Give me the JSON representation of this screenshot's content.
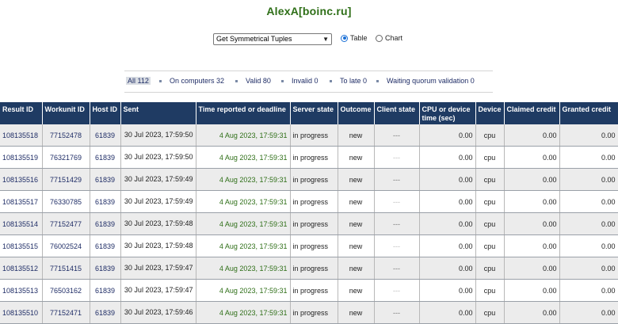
{
  "page": {
    "title": "AlexA[boinc.ru]"
  },
  "controls": {
    "app_select": "Get Symmetrical Tuples",
    "view_table_label": "Table",
    "view_chart_label": "Chart",
    "selected_view": "table"
  },
  "filters": [
    {
      "label": "All 112",
      "active": true
    },
    {
      "label": "On computers 32",
      "active": false
    },
    {
      "label": "Valid 80",
      "active": false
    },
    {
      "label": "Invalid 0",
      "active": false
    },
    {
      "label": "To late 0",
      "active": false
    },
    {
      "label": "Waiting quorum validation 0",
      "active": false
    }
  ],
  "table": {
    "headers": [
      "Result ID",
      "Workunit ID",
      "Host ID",
      "Sent",
      "Time reported or deadline",
      "Server state",
      "Outcome",
      "Client state",
      "CPU or device time (sec)",
      "Device",
      "Claimed credit",
      "Granted credit"
    ],
    "rows": [
      {
        "result_id": "108135518",
        "workunit_id": "77152478",
        "host_id": "61839",
        "sent": "30 Jul 2023, 17:59:50",
        "deadline": "4 Aug 2023, 17:59:31",
        "server_state": "in progress",
        "outcome": "new",
        "client_state": "---",
        "cpu_time": "0.00",
        "device": "cpu",
        "claimed": "0.00",
        "granted": "0.00"
      },
      {
        "result_id": "108135519",
        "workunit_id": "76321769",
        "host_id": "61839",
        "sent": "30 Jul 2023, 17:59:50",
        "deadline": "4 Aug 2023, 17:59:31",
        "server_state": "in progress",
        "outcome": "new",
        "client_state": "---",
        "cpu_time": "0.00",
        "device": "cpu",
        "claimed": "0.00",
        "granted": "0.00"
      },
      {
        "result_id": "108135516",
        "workunit_id": "77151429",
        "host_id": "61839",
        "sent": "30 Jul 2023, 17:59:49",
        "deadline": "4 Aug 2023, 17:59:31",
        "server_state": "in progress",
        "outcome": "new",
        "client_state": "---",
        "cpu_time": "0.00",
        "device": "cpu",
        "claimed": "0.00",
        "granted": "0.00"
      },
      {
        "result_id": "108135517",
        "workunit_id": "76330785",
        "host_id": "61839",
        "sent": "30 Jul 2023, 17:59:49",
        "deadline": "4 Aug 2023, 17:59:31",
        "server_state": "in progress",
        "outcome": "new",
        "client_state": "---",
        "cpu_time": "0.00",
        "device": "cpu",
        "claimed": "0.00",
        "granted": "0.00"
      },
      {
        "result_id": "108135514",
        "workunit_id": "77152477",
        "host_id": "61839",
        "sent": "30 Jul 2023, 17:59:48",
        "deadline": "4 Aug 2023, 17:59:31",
        "server_state": "in progress",
        "outcome": "new",
        "client_state": "---",
        "cpu_time": "0.00",
        "device": "cpu",
        "claimed": "0.00",
        "granted": "0.00"
      },
      {
        "result_id": "108135515",
        "workunit_id": "76002524",
        "host_id": "61839",
        "sent": "30 Jul 2023, 17:59:48",
        "deadline": "4 Aug 2023, 17:59:31",
        "server_state": "in progress",
        "outcome": "new",
        "client_state": "---",
        "cpu_time": "0.00",
        "device": "cpu",
        "claimed": "0.00",
        "granted": "0.00"
      },
      {
        "result_id": "108135512",
        "workunit_id": "77151415",
        "host_id": "61839",
        "sent": "30 Jul 2023, 17:59:47",
        "deadline": "4 Aug 2023, 17:59:31",
        "server_state": "in progress",
        "outcome": "new",
        "client_state": "---",
        "cpu_time": "0.00",
        "device": "cpu",
        "claimed": "0.00",
        "granted": "0.00"
      },
      {
        "result_id": "108135513",
        "workunit_id": "76503162",
        "host_id": "61839",
        "sent": "30 Jul 2023, 17:59:47",
        "deadline": "4 Aug 2023, 17:59:31",
        "server_state": "in progress",
        "outcome": "new",
        "client_state": "---",
        "cpu_time": "0.00",
        "device": "cpu",
        "claimed": "0.00",
        "granted": "0.00"
      },
      {
        "result_id": "108135510",
        "workunit_id": "77152471",
        "host_id": "61839",
        "sent": "30 Jul 2023, 17:59:46",
        "deadline": "4 Aug 2023, 17:59:31",
        "server_state": "in progress",
        "outcome": "new",
        "client_state": "---",
        "cpu_time": "0.00",
        "device": "cpu",
        "claimed": "0.00",
        "granted": "0.00"
      }
    ]
  },
  "colors": {
    "title_green": "#2f6f18",
    "header_bg": "#1f3b63",
    "link_blue": "#1f2d66",
    "row_alt_bg": "#ececec",
    "radio_accent": "#1a6fd6"
  }
}
